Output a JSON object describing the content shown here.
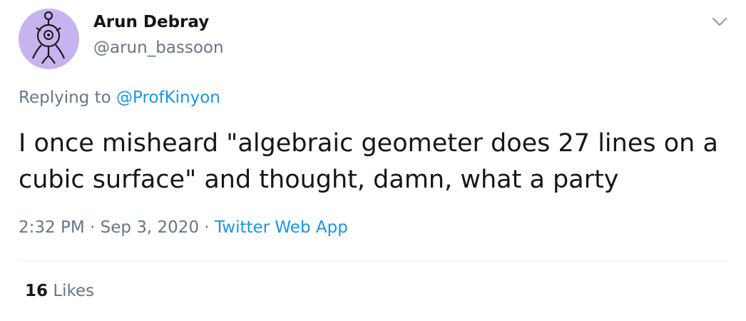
{
  "tweet": {
    "author": {
      "display_name": "Arun Debray",
      "handle": "@arun_bassoon",
      "avatar": "hand-drawn-creature-avatar"
    },
    "reply": {
      "prefix": "Replying to",
      "mention": "@ProfKinyon"
    },
    "text": "I once misheard \"algebraic geometer does 27 lines on a cubic surface\" and thought, damn, what a party",
    "time": "2:32 PM",
    "separator": "·",
    "date": "Sep 3, 2020",
    "source": "Twitter Web App",
    "likes": {
      "count": "16",
      "label": "Likes"
    },
    "menu_icon": "chevron-down-icon"
  },
  "colors": {
    "text_primary": "#14171a",
    "text_secondary": "#657786",
    "link": "#1b95e0",
    "avatar_bg": "#c6b3ef",
    "divider": "#e6ecf0"
  }
}
